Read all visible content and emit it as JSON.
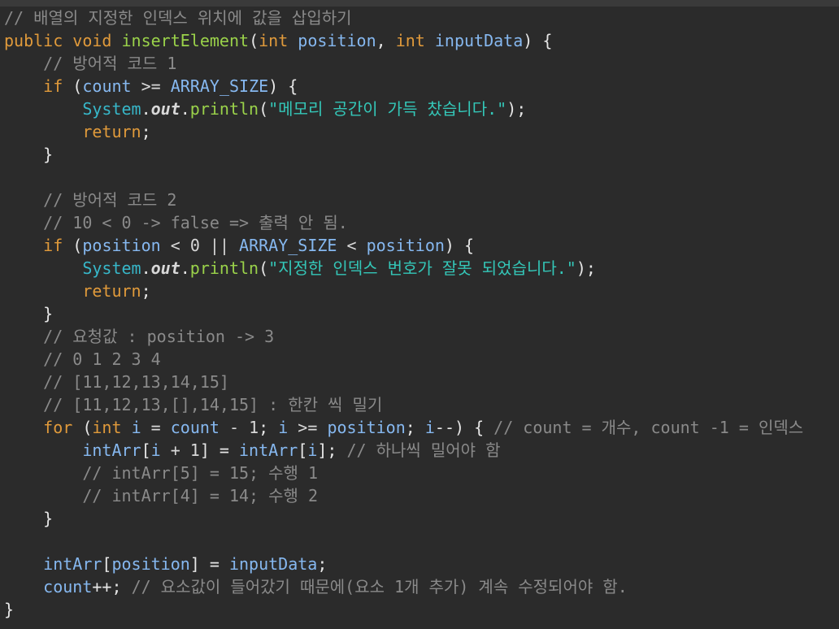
{
  "editor": {
    "lines": [
      [
        {
          "t": "// 배열의 지정한 인덱스 위치에 값을 삽입하기",
          "k": "com"
        }
      ],
      [
        {
          "t": "public",
          "k": "kw"
        },
        {
          "t": " ",
          "k": "plain"
        },
        {
          "t": "void",
          "k": "kw"
        },
        {
          "t": " ",
          "k": "plain"
        },
        {
          "t": "insertElement",
          "k": "fn"
        },
        {
          "t": "(",
          "k": "plain"
        },
        {
          "t": "int",
          "k": "type"
        },
        {
          "t": " ",
          "k": "plain"
        },
        {
          "t": "position",
          "k": "var"
        },
        {
          "t": ", ",
          "k": "plain"
        },
        {
          "t": "int",
          "k": "type"
        },
        {
          "t": " ",
          "k": "plain"
        },
        {
          "t": "inputData",
          "k": "var"
        },
        {
          "t": ") {",
          "k": "plain"
        }
      ],
      [
        {
          "t": "    // 방어적 코드 1",
          "k": "com"
        }
      ],
      [
        {
          "t": "    ",
          "k": "plain"
        },
        {
          "t": "if",
          "k": "kw"
        },
        {
          "t": " (",
          "k": "plain"
        },
        {
          "t": "count",
          "k": "var"
        },
        {
          "t": " >= ",
          "k": "op"
        },
        {
          "t": "ARRAY_SIZE",
          "k": "const"
        },
        {
          "t": ") {",
          "k": "plain"
        }
      ],
      [
        {
          "t": "        ",
          "k": "plain"
        },
        {
          "t": "System",
          "k": "cls"
        },
        {
          "t": ".",
          "k": "plain"
        },
        {
          "t": "out",
          "k": "static"
        },
        {
          "t": ".",
          "k": "plain"
        },
        {
          "t": "println",
          "k": "fn"
        },
        {
          "t": "(",
          "k": "plain"
        },
        {
          "t": "\"메모리 공간이 가득 찼습니다.\"",
          "k": "str"
        },
        {
          "t": ");",
          "k": "plain"
        }
      ],
      [
        {
          "t": "        ",
          "k": "plain"
        },
        {
          "t": "return",
          "k": "kw"
        },
        {
          "t": ";",
          "k": "plain"
        }
      ],
      [
        {
          "t": "    }",
          "k": "plain"
        }
      ],
      [
        {
          "t": "",
          "k": "plain"
        }
      ],
      [
        {
          "t": "    // 방어적 코드 2",
          "k": "com"
        }
      ],
      [
        {
          "t": "    // 10 < 0 -> false => 출력 안 됨.",
          "k": "com"
        }
      ],
      [
        {
          "t": "    ",
          "k": "plain"
        },
        {
          "t": "if",
          "k": "kw"
        },
        {
          "t": " (",
          "k": "plain"
        },
        {
          "t": "position",
          "k": "var"
        },
        {
          "t": " < ",
          "k": "op"
        },
        {
          "t": "0",
          "k": "num"
        },
        {
          "t": " || ",
          "k": "op"
        },
        {
          "t": "ARRAY_SIZE",
          "k": "const"
        },
        {
          "t": " < ",
          "k": "op"
        },
        {
          "t": "position",
          "k": "var"
        },
        {
          "t": ") {",
          "k": "plain"
        }
      ],
      [
        {
          "t": "        ",
          "k": "plain"
        },
        {
          "t": "System",
          "k": "cls"
        },
        {
          "t": ".",
          "k": "plain"
        },
        {
          "t": "out",
          "k": "static"
        },
        {
          "t": ".",
          "k": "plain"
        },
        {
          "t": "println",
          "k": "fn"
        },
        {
          "t": "(",
          "k": "plain"
        },
        {
          "t": "\"지정한 인덱스 번호가 잘못 되었습니다.\"",
          "k": "str"
        },
        {
          "t": ");",
          "k": "plain"
        }
      ],
      [
        {
          "t": "        ",
          "k": "plain"
        },
        {
          "t": "return",
          "k": "kw"
        },
        {
          "t": ";",
          "k": "plain"
        }
      ],
      [
        {
          "t": "    }",
          "k": "plain"
        }
      ],
      [
        {
          "t": "    // 요청값 : position -> 3",
          "k": "com"
        }
      ],
      [
        {
          "t": "    // 0 1 2 3 4",
          "k": "com"
        }
      ],
      [
        {
          "t": "    // [11,12,13,14,15]",
          "k": "com"
        }
      ],
      [
        {
          "t": "    // [11,12,13,[],14,15] : 한칸 씩 밀기",
          "k": "com"
        }
      ],
      [
        {
          "t": "    ",
          "k": "plain"
        },
        {
          "t": "for",
          "k": "kw"
        },
        {
          "t": " (",
          "k": "plain"
        },
        {
          "t": "int",
          "k": "type"
        },
        {
          "t": " ",
          "k": "plain"
        },
        {
          "t": "i",
          "k": "var"
        },
        {
          "t": " = ",
          "k": "op"
        },
        {
          "t": "count",
          "k": "var"
        },
        {
          "t": " - ",
          "k": "op"
        },
        {
          "t": "1",
          "k": "num"
        },
        {
          "t": "; ",
          "k": "plain"
        },
        {
          "t": "i",
          "k": "var"
        },
        {
          "t": " >= ",
          "k": "op"
        },
        {
          "t": "position",
          "k": "var"
        },
        {
          "t": "; ",
          "k": "plain"
        },
        {
          "t": "i",
          "k": "var"
        },
        {
          "t": "--) { ",
          "k": "plain"
        },
        {
          "t": "// count = 개수, count -1 = 인덱스",
          "k": "com"
        }
      ],
      [
        {
          "t": "        ",
          "k": "plain"
        },
        {
          "t": "intArr",
          "k": "var"
        },
        {
          "t": "[",
          "k": "plain"
        },
        {
          "t": "i",
          "k": "var"
        },
        {
          "t": " + ",
          "k": "op"
        },
        {
          "t": "1",
          "k": "num"
        },
        {
          "t": "] = ",
          "k": "plain"
        },
        {
          "t": "intArr",
          "k": "var"
        },
        {
          "t": "[",
          "k": "plain"
        },
        {
          "t": "i",
          "k": "var"
        },
        {
          "t": "]; ",
          "k": "plain"
        },
        {
          "t": "// 하나씩 밀어야 함",
          "k": "com"
        }
      ],
      [
        {
          "t": "        // intArr[5] = 15; 수행 1",
          "k": "com"
        }
      ],
      [
        {
          "t": "        // intArr[4] = 14; 수행 2",
          "k": "com"
        }
      ],
      [
        {
          "t": "    }",
          "k": "plain"
        }
      ],
      [
        {
          "t": "",
          "k": "plain"
        }
      ],
      [
        {
          "t": "    ",
          "k": "plain"
        },
        {
          "t": "intArr",
          "k": "var"
        },
        {
          "t": "[",
          "k": "plain"
        },
        {
          "t": "position",
          "k": "var"
        },
        {
          "t": "] = ",
          "k": "plain"
        },
        {
          "t": "inputData",
          "k": "var"
        },
        {
          "t": ";",
          "k": "plain"
        }
      ],
      [
        {
          "t": "    ",
          "k": "plain"
        },
        {
          "t": "count",
          "k": "var"
        },
        {
          "t": "++; ",
          "k": "plain"
        },
        {
          "t": "// 요소값이 들어갔기 때문에(요소 1개 추가) 계속 수정되어야 함.",
          "k": "com"
        }
      ],
      [
        {
          "t": "}",
          "k": "plain"
        }
      ]
    ]
  }
}
